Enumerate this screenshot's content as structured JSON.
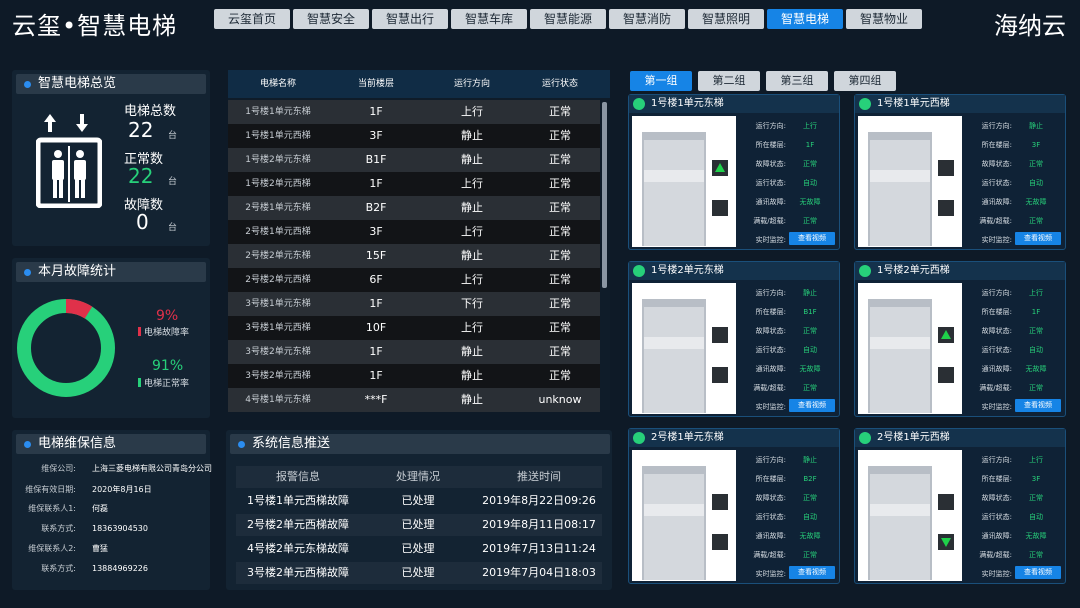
{
  "app": {
    "title": "云玺•智慧电梯",
    "brand_right": "海纳云"
  },
  "nav": [
    "云玺首页",
    "智慧安全",
    "智慧出行",
    "智慧车库",
    "智慧能源",
    "智慧消防",
    "智慧照明",
    "智慧电梯",
    "智慧物业"
  ],
  "nav_active_index": 7,
  "overview": {
    "title": "智慧电梯总览",
    "total_label": "电梯总数",
    "total_value": "22",
    "total_unit": "台",
    "normal_label": "正常数",
    "normal_value": "22",
    "normal_unit": "台",
    "fault_label": "故障数",
    "fault_value": "0",
    "fault_unit": "台"
  },
  "fault_stats": {
    "title": "本月故障统计",
    "fault_pct": "9%",
    "fault_label": "电梯故障率",
    "normal_pct": "91%",
    "normal_label": "电梯正常率",
    "fault_fraction": 0.09
  },
  "maintenance": {
    "title": "电梯维保信息",
    "rows": [
      {
        "k": "维保公司:",
        "v": "上海三菱电梯有限公司青岛分公司"
      },
      {
        "k": "维保有效日期:",
        "v": "2020年8月16日"
      },
      {
        "k": "维保联系人1:",
        "v": "何磊"
      },
      {
        "k": "联系方式:",
        "v": "18363904530"
      },
      {
        "k": "维保联系人2:",
        "v": "曹猛"
      },
      {
        "k": "联系方式:",
        "v": "13884969226"
      }
    ]
  },
  "elevator_table": {
    "headers": [
      "电梯名称",
      "当前楼层",
      "运行方向",
      "运行状态"
    ],
    "rows": [
      [
        "1号楼1单元东梯",
        "1F",
        "上行",
        "正常"
      ],
      [
        "1号楼1单元西梯",
        "3F",
        "静止",
        "正常"
      ],
      [
        "1号楼2单元东梯",
        "B1F",
        "静止",
        "正常"
      ],
      [
        "1号楼2单元西梯",
        "1F",
        "上行",
        "正常"
      ],
      [
        "2号楼1单元东梯",
        "B2F",
        "静止",
        "正常"
      ],
      [
        "2号楼1单元西梯",
        "3F",
        "上行",
        "正常"
      ],
      [
        "2号楼2单元东梯",
        "15F",
        "静止",
        "正常"
      ],
      [
        "2号楼2单元西梯",
        "6F",
        "上行",
        "正常"
      ],
      [
        "3号楼1单元东梯",
        "1F",
        "下行",
        "正常"
      ],
      [
        "3号楼1单元西梯",
        "10F",
        "上行",
        "正常"
      ],
      [
        "3号楼2单元东梯",
        "1F",
        "静止",
        "正常"
      ],
      [
        "3号楼2单元西梯",
        "1F",
        "静止",
        "正常"
      ],
      [
        "4号楼1单元东梯",
        "***F",
        "静止",
        "unknow"
      ]
    ]
  },
  "messages": {
    "title": "系统信息推送",
    "headers": [
      "报警信息",
      "处理情况",
      "推送时间"
    ],
    "rows": [
      [
        "1号楼1单元西梯故障",
        "已处理",
        "2019年8月22日09:26"
      ],
      [
        "2号楼2单元西梯故障",
        "已处理",
        "2019年8月11日08:17"
      ],
      [
        "4号楼2单元东梯故障",
        "已处理",
        "2019年7月13日11:24"
      ],
      [
        "3号楼2单元西梯故障",
        "已处理",
        "2019年7月04日18:03"
      ]
    ]
  },
  "groups": {
    "tabs": [
      "第一组",
      "第二组",
      "第三组",
      "第四组"
    ],
    "active_index": 0
  },
  "info_keys": [
    "运行方向:",
    "所在楼层:",
    "故障状态:",
    "运行状态:",
    "通讯故障:",
    "满载/超载:",
    "实时监控:"
  ],
  "view_label": "查看视频",
  "cards": [
    {
      "title": "1号楼1单元东梯",
      "vals": [
        "上行",
        "1F",
        "正常",
        "自动",
        "无故障",
        "正常"
      ],
      "arrow": "up"
    },
    {
      "title": "1号楼1单元西梯",
      "vals": [
        "静止",
        "3F",
        "正常",
        "自动",
        "无故障",
        "正常"
      ],
      "arrow": "none"
    },
    {
      "title": "1号楼2单元东梯",
      "vals": [
        "静止",
        "B1F",
        "正常",
        "自动",
        "无故障",
        "正常"
      ],
      "arrow": "none"
    },
    {
      "title": "1号楼2单元西梯",
      "vals": [
        "上行",
        "1F",
        "正常",
        "自动",
        "无故障",
        "正常"
      ],
      "arrow": "up"
    },
    {
      "title": "2号楼1单元东梯",
      "vals": [
        "静止",
        "B2F",
        "正常",
        "自动",
        "无故障",
        "正常"
      ],
      "arrow": "none"
    },
    {
      "title": "2号楼1单元西梯",
      "vals": [
        "上行",
        "3F",
        "正常",
        "自动",
        "无故障",
        "正常"
      ],
      "arrow": "down"
    }
  ],
  "colors": {
    "accent": "#1684e6",
    "ok": "#27d07a",
    "fault": "#e0314a",
    "panel": "#132332"
  }
}
